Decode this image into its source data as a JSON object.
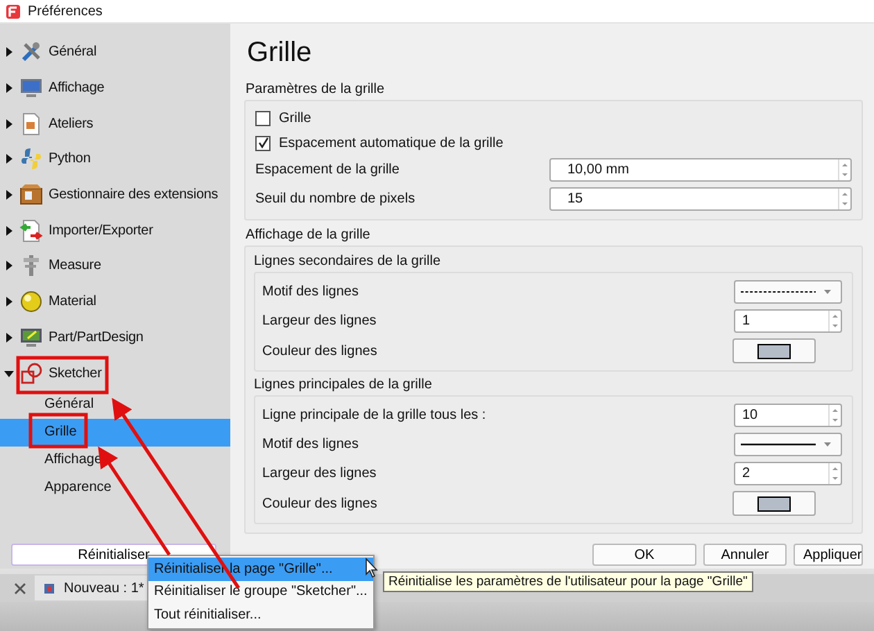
{
  "window": {
    "title": "Préférences"
  },
  "sidebar": {
    "items": [
      {
        "label": "Général",
        "expanded": false
      },
      {
        "label": "Affichage",
        "expanded": false
      },
      {
        "label": "Ateliers",
        "expanded": false
      },
      {
        "label": "Python",
        "expanded": false
      },
      {
        "label": "Gestionnaire des extensions",
        "expanded": false
      },
      {
        "label": "Importer/Exporter",
        "expanded": false
      },
      {
        "label": "Measure",
        "expanded": false
      },
      {
        "label": "Material",
        "expanded": false
      },
      {
        "label": "Part/PartDesign",
        "expanded": false
      },
      {
        "label": "Sketcher",
        "expanded": true,
        "children": [
          {
            "label": "Général",
            "selected": false
          },
          {
            "label": "Grille",
            "selected": true
          },
          {
            "label": "Affichage",
            "selected": false
          },
          {
            "label": "Apparence",
            "selected": false
          }
        ]
      }
    ],
    "reset_button": "Réinitialiser"
  },
  "page": {
    "title": "Grille",
    "parameters": {
      "title": "Paramètres de la grille",
      "rows": [
        {
          "kind": "checkbox",
          "label": "Grille",
          "checked": false
        },
        {
          "kind": "checkbox",
          "label": "Espacement automatique de la grille",
          "checked": true
        },
        {
          "kind": "spin",
          "label": "Espacement de la grille",
          "value": "10,00 mm"
        },
        {
          "kind": "spin",
          "label": "Seuil du nombre de pixels",
          "value": "15"
        }
      ]
    },
    "display": {
      "title": "Affichage de la grille",
      "groups": [
        {
          "title": "Lignes secondaires de la grille",
          "rows": [
            {
              "kind": "dashed-combo",
              "label": "Motif des lignes"
            },
            {
              "kind": "spin",
              "label": "Largeur des lignes",
              "value": "1"
            },
            {
              "kind": "color",
              "label": "Couleur des lignes",
              "color": "#b4bcc8"
            }
          ]
        },
        {
          "title": "Lignes principales de la grille",
          "rows": [
            {
              "kind": "spin",
              "label": "Ligne principale de la grille tous les :",
              "value": "10"
            },
            {
              "kind": "solid-combo",
              "label": "Motif des lignes"
            },
            {
              "kind": "spin",
              "label": "Largeur des lignes",
              "value": "2"
            },
            {
              "kind": "color",
              "label": "Couleur des lignes",
              "color": "#b4bcc8"
            }
          ]
        }
      ]
    }
  },
  "buttons": [
    "OK",
    "Annuler",
    "Appliquer"
  ],
  "document_tab": {
    "label": "Nouveau : 1*"
  },
  "context_menu": {
    "items": [
      {
        "label": "Réinitialiser la page \"Grille\"...",
        "selected": true
      },
      {
        "label": "Réinitialiser le groupe \"Sketcher\"...",
        "selected": false
      },
      {
        "label": "Tout réinitialiser...",
        "selected": false
      }
    ]
  },
  "tooltip": {
    "text": "Réinitialise les paramètres de l'utilisateur pour la page \"Grille\""
  }
}
